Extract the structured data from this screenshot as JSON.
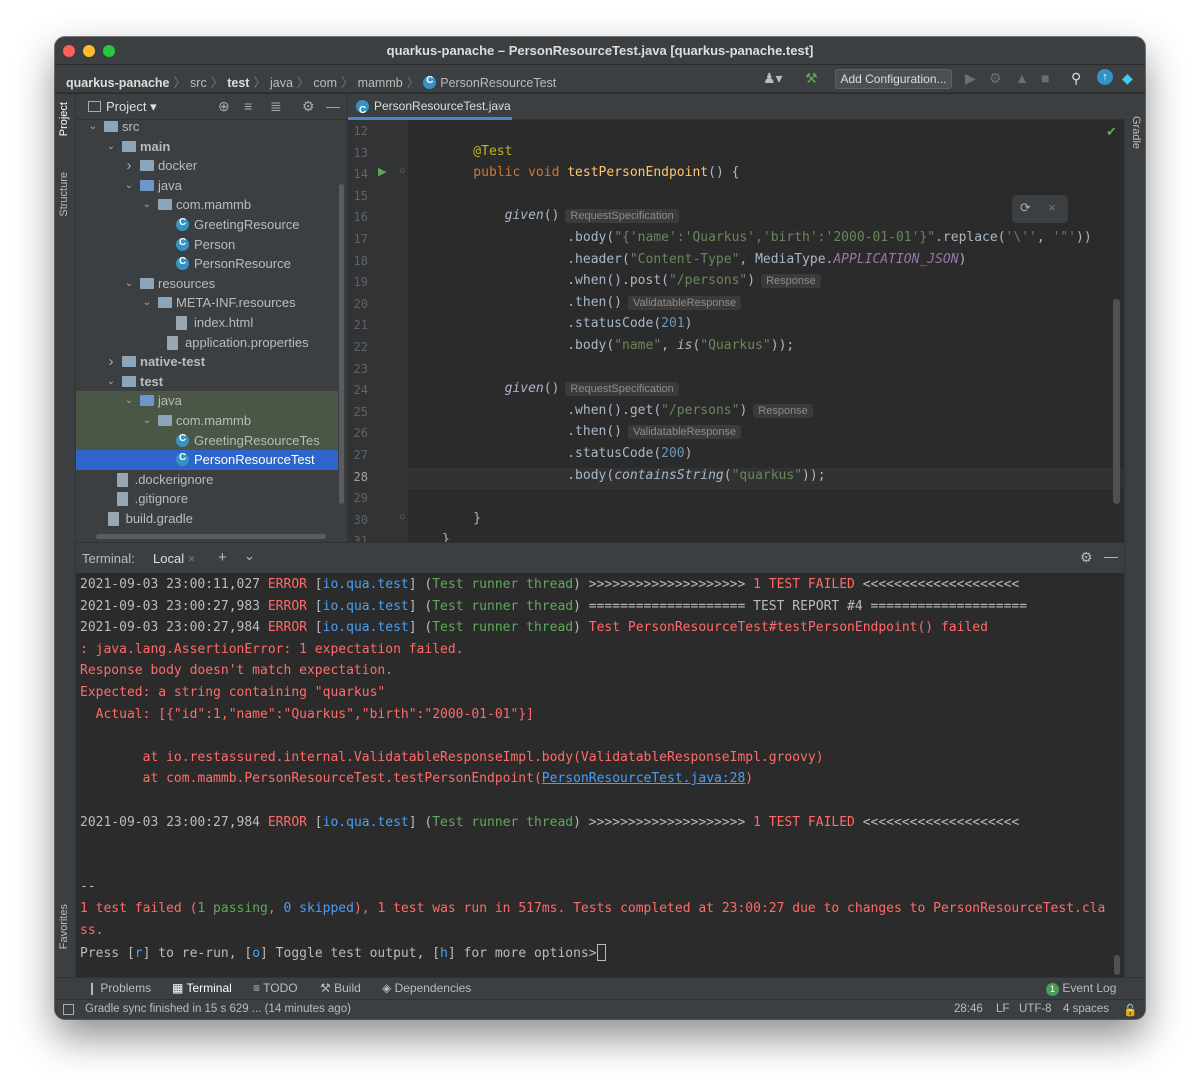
{
  "window": {
    "title": "quarkus-panache – PersonResourceTest.java [quarkus-panache.test]"
  },
  "breadcrumbs": [
    "quarkus-panache",
    "src",
    "test",
    "java",
    "com",
    "mammb",
    "PersonResourceTest"
  ],
  "toolbar": {
    "add_configuration": "Add Configuration..."
  },
  "left_stripe": {
    "project": "Project",
    "structure": "Structure",
    "favorites": "Favorites"
  },
  "right_stripe": {
    "gradle": "Gradle"
  },
  "project_panel": {
    "title": "Project",
    "tree": [
      {
        "label": "src",
        "depth": 1,
        "arrow": "down",
        "icon": "folder"
      },
      {
        "label": "main",
        "depth": 2,
        "arrow": "down",
        "icon": "folder",
        "bold": true
      },
      {
        "label": "docker",
        "depth": 3,
        "arrow": "right",
        "icon": "folder"
      },
      {
        "label": "java",
        "depth": 3,
        "arrow": "down",
        "icon": "folder-blue"
      },
      {
        "label": "com.mammb",
        "depth": 4,
        "arrow": "down",
        "icon": "package"
      },
      {
        "label": "GreetingResource",
        "depth": 5,
        "icon": "class"
      },
      {
        "label": "Person",
        "depth": 5,
        "icon": "class"
      },
      {
        "label": "PersonResource",
        "depth": 5,
        "icon": "class"
      },
      {
        "label": "resources",
        "depth": 3,
        "arrow": "down",
        "icon": "folder"
      },
      {
        "label": "META-INF.resources",
        "depth": 4,
        "arrow": "down",
        "icon": "folder"
      },
      {
        "label": "index.html",
        "depth": 5,
        "icon": "file"
      },
      {
        "label": "application.properties",
        "depth": 4.5,
        "icon": "file"
      },
      {
        "label": "native-test",
        "depth": 2,
        "arrow": "right",
        "icon": "folder",
        "bold": true
      },
      {
        "label": "test",
        "depth": 2,
        "arrow": "down",
        "icon": "folder",
        "bold": true
      },
      {
        "label": "java",
        "depth": 3,
        "arrow": "down",
        "icon": "folder-blue",
        "state": "hl"
      },
      {
        "label": "com.mammb",
        "depth": 4,
        "arrow": "down",
        "icon": "package",
        "state": "hl"
      },
      {
        "label": "GreetingResourceTes",
        "depth": 5,
        "icon": "class",
        "state": "hl"
      },
      {
        "label": "PersonResourceTest",
        "depth": 5,
        "icon": "class",
        "state": "sel"
      },
      {
        "label": ".dockerignore",
        "depth": 1.7,
        "icon": "file"
      },
      {
        "label": ".gitignore",
        "depth": 1.7,
        "icon": "file"
      },
      {
        "label": "build.gradle",
        "depth": 1.2,
        "icon": "file"
      }
    ]
  },
  "editor": {
    "tab": "PersonResourceTest.java",
    "line_numbers": [
      "12",
      "13",
      "14",
      "15",
      "16",
      "17",
      "18",
      "19",
      "20",
      "21",
      "22",
      "23",
      "24",
      "25",
      "26",
      "27",
      "28",
      "29",
      "30",
      "31"
    ],
    "current_line": "28",
    "lines": [
      [],
      [
        {
          "t": "    @Test",
          "c": "ann"
        }
      ],
      [
        {
          "t": "    public void ",
          "c": "kw"
        },
        {
          "t": "testPersonEndpoint",
          "c": "fn"
        },
        {
          "t": "() {"
        }
      ],
      [],
      [
        {
          "t": "        "
        },
        {
          "t": "given",
          "c": "it"
        },
        {
          "t": "()"
        },
        {
          "h": "RequestSpecification"
        }
      ],
      [
        {
          "t": "                .body("
        },
        {
          "t": "\"{'name':'Quarkus','birth':'2000-01-01'}\"",
          "c": "str"
        },
        {
          "t": ".replace("
        },
        {
          "t": "'\\''",
          "c": "str"
        },
        {
          "t": ", "
        },
        {
          "t": "'\"'",
          "c": "str"
        },
        {
          "t": "))"
        }
      ],
      [
        {
          "t": "                .header("
        },
        {
          "t": "\"Content-Type\"",
          "c": "str"
        },
        {
          "t": ", MediaType."
        },
        {
          "t": "APPLICATION_JSON",
          "c": "cst"
        },
        {
          "t": ")"
        }
      ],
      [
        {
          "t": "                .when().post("
        },
        {
          "t": "\"/persons\"",
          "c": "str"
        },
        {
          "t": ")"
        },
        {
          "h": "Response"
        }
      ],
      [
        {
          "t": "                .then()"
        },
        {
          "h": "ValidatableResponse"
        }
      ],
      [
        {
          "t": "                .statusCode("
        },
        {
          "t": "201",
          "c": "num"
        },
        {
          "t": ")"
        }
      ],
      [
        {
          "t": "                .body("
        },
        {
          "t": "\"name\"",
          "c": "str"
        },
        {
          "t": ", "
        },
        {
          "t": "is",
          "c": "it"
        },
        {
          "t": "("
        },
        {
          "t": "\"Quarkus\"",
          "c": "str"
        },
        {
          "t": "));"
        }
      ],
      [],
      [
        {
          "t": "        "
        },
        {
          "t": "given",
          "c": "it"
        },
        {
          "t": "()"
        },
        {
          "h": "RequestSpecification"
        }
      ],
      [
        {
          "t": "                .when().get("
        },
        {
          "t": "\"/persons\"",
          "c": "str"
        },
        {
          "t": ")"
        },
        {
          "h": "Response"
        }
      ],
      [
        {
          "t": "                .then()"
        },
        {
          "h": "ValidatableResponse"
        }
      ],
      [
        {
          "t": "                .statusCode("
        },
        {
          "t": "200",
          "c": "num"
        },
        {
          "t": ")"
        }
      ],
      [
        {
          "t": "                .body("
        },
        {
          "t": "containsString",
          "c": "it"
        },
        {
          "t": "("
        },
        {
          "t": "\"quarkus\"",
          "c": "str"
        },
        {
          "t": "));"
        }
      ],
      [],
      [
        {
          "t": "    }"
        }
      ],
      [
        {
          "t": "}"
        }
      ]
    ]
  },
  "terminal": {
    "title": "Terminal:",
    "tab": "Local",
    "lines": [
      [
        {
          "t": "2021-09-03 23:00:11,027 "
        },
        {
          "t": "ERROR",
          "c": "r"
        },
        {
          "t": " ["
        },
        {
          "t": "io.qua.test",
          "c": "b"
        },
        {
          "t": "] ("
        },
        {
          "t": "Test runner thread",
          "c": "g"
        },
        {
          "t": ") >>>>>>>>>>>>>>>>>>>> "
        },
        {
          "t": "1 TEST FAILED",
          "c": "r"
        },
        {
          "t": " <<<<<<<<<<<<<<<<<<<<"
        }
      ],
      [
        {
          "t": "2021-09-03 23:00:27,983 "
        },
        {
          "t": "ERROR",
          "c": "r"
        },
        {
          "t": " ["
        },
        {
          "t": "io.qua.test",
          "c": "b"
        },
        {
          "t": "] ("
        },
        {
          "t": "Test runner thread",
          "c": "g"
        },
        {
          "t": ") ==================== TEST REPORT #4 ===================="
        }
      ],
      [
        {
          "t": "2021-09-03 23:00:27,984 "
        },
        {
          "t": "ERROR",
          "c": "r"
        },
        {
          "t": " ["
        },
        {
          "t": "io.qua.test",
          "c": "b"
        },
        {
          "t": "] ("
        },
        {
          "t": "Test runner thread",
          "c": "g"
        },
        {
          "t": ") "
        },
        {
          "t": "Test PersonResourceTest#testPersonEndpoint() failed",
          "c": "r"
        }
      ],
      [
        {
          "t": ": java.lang.AssertionError: 1 expectation failed.",
          "c": "r"
        }
      ],
      [
        {
          "t": "Response body doesn't match expectation.",
          "c": "r"
        }
      ],
      [
        {
          "t": "Expected: a string containing \"quarkus\"",
          "c": "r"
        }
      ],
      [
        {
          "t": "  Actual: [{\"id\":1,\"name\":\"Quarkus\",\"birth\":\"2000-01-01\"}]",
          "c": "r"
        }
      ],
      [],
      [
        {
          "t": "        at io.restassured.internal.ValidatableResponseImpl.body(ValidatableResponseImpl.groovy)",
          "c": "r"
        }
      ],
      [
        {
          "t": "        at com.mammb.PersonResourceTest.testPersonEndpoint(",
          "c": "r"
        },
        {
          "t": "PersonResourceTest.java:28",
          "c": "link"
        },
        {
          "t": ")",
          "c": "r"
        }
      ],
      [],
      [
        {
          "t": "2021-09-03 23:00:27,984 "
        },
        {
          "t": "ERROR",
          "c": "r"
        },
        {
          "t": " ["
        },
        {
          "t": "io.qua.test",
          "c": "b"
        },
        {
          "t": "] ("
        },
        {
          "t": "Test runner thread",
          "c": "g"
        },
        {
          "t": ") >>>>>>>>>>>>>>>>>>>> "
        },
        {
          "t": "1 TEST FAILED",
          "c": "r"
        },
        {
          "t": " <<<<<<<<<<<<<<<<<<<<"
        }
      ],
      [],
      [],
      [
        {
          "t": "--"
        }
      ],
      [
        {
          "t": "1 test failed (",
          "c": "r"
        },
        {
          "t": "1 passing",
          "c": "g"
        },
        {
          "t": ", ",
          "c": "r"
        },
        {
          "t": "0 skipped",
          "c": "b"
        },
        {
          "t": "), ",
          "c": "r"
        },
        {
          "t": "1 test was run in 517ms. Tests completed at 23:00:27 due to changes to PersonResourceTest.cla",
          "c": "r"
        }
      ],
      [
        {
          "t": "ss.",
          "c": "r"
        }
      ],
      [
        {
          "t": "Press ["
        },
        {
          "t": "r",
          "c": "b"
        },
        {
          "t": "] to re-run, ["
        },
        {
          "t": "o",
          "c": "b"
        },
        {
          "t": "] Toggle test output, ["
        },
        {
          "t": "h",
          "c": "b"
        },
        {
          "t": "] for more options>"
        },
        {
          "cursor": true
        }
      ]
    ]
  },
  "tool_windows": {
    "problems": "Problems",
    "terminal": "Terminal",
    "todo": "TODO",
    "build": "Build",
    "dependencies": "Dependencies",
    "event_log": "Event Log",
    "event_count": "1"
  },
  "status": {
    "message": "Gradle sync finished in 15 s 629 ... (14 minutes ago)",
    "position": "28:46",
    "line_sep": "LF",
    "encoding": "UTF-8",
    "indent": "4 spaces"
  }
}
